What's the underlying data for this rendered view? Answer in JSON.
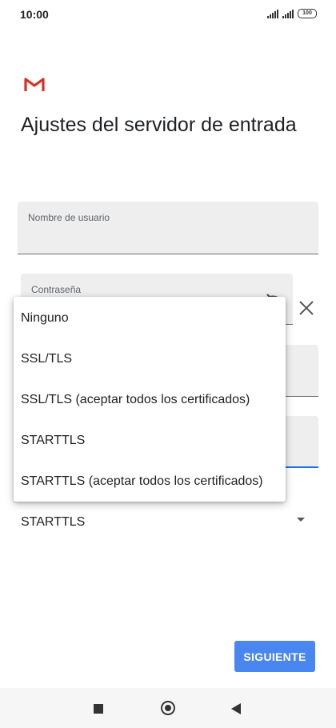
{
  "status_bar": {
    "time": "10:00",
    "battery": "100"
  },
  "icons": {
    "logo": "gmail-logo-icon",
    "password_toggle": "eye-off-icon",
    "close": "close-icon",
    "dropdown_caret": "caret-down-icon"
  },
  "colors": {
    "accent": "#4a86f0",
    "focus_underline": "#1a73e8",
    "gmail_red": "#d93025"
  },
  "page": {
    "title": "Ajustes del servidor de entrada"
  },
  "form": {
    "username": {
      "label": "Nombre de usuario",
      "value": ""
    },
    "password": {
      "label": "Contraseña",
      "value": ""
    },
    "security": {
      "selected": "STARTTLS"
    }
  },
  "dropdown": {
    "options": [
      "Ninguno",
      "SSL/TLS",
      "SSL/TLS (aceptar todos los certificados)",
      "STARTTLS",
      "STARTTLS (aceptar todos los certificados)"
    ]
  },
  "actions": {
    "next_label": "SIGUIENTE"
  }
}
